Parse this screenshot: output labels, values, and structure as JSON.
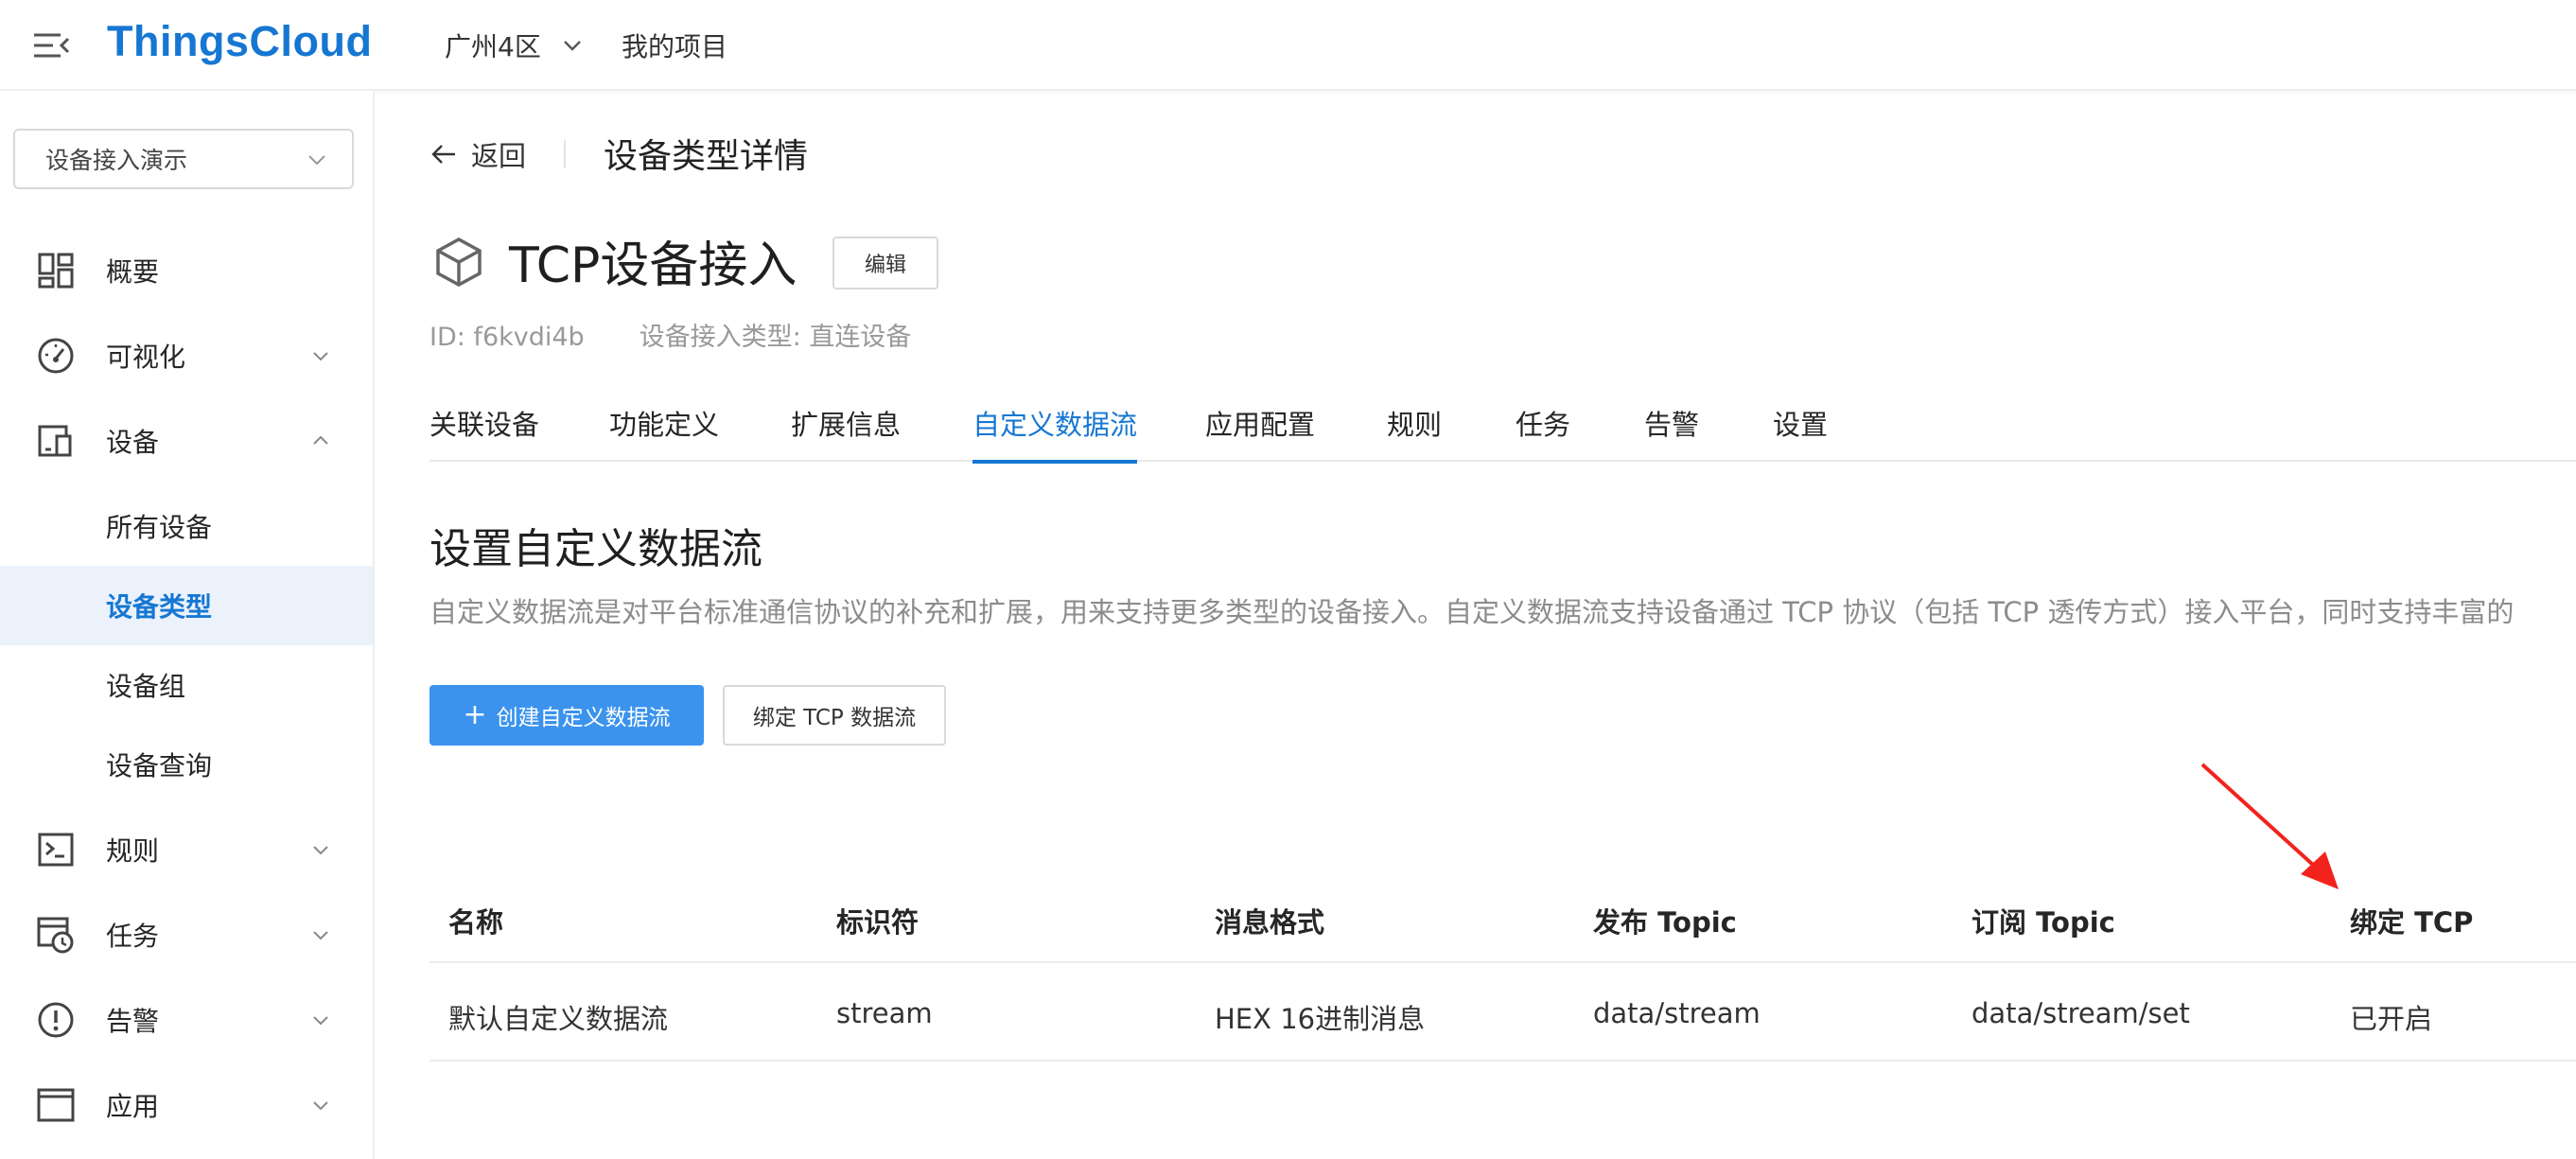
{
  "topbar": {
    "brand": "ThingsCloud",
    "region": "广州4区",
    "projects_link": "我的项目",
    "menu_icon": "menu-fold-icon"
  },
  "sidebar": {
    "project_select": "设备接入演示",
    "items": [
      {
        "label": "概要",
        "icon": "dashboard-icon"
      },
      {
        "label": "可视化",
        "icon": "gauge-icon"
      },
      {
        "label": "设备",
        "icon": "device-icon"
      },
      {
        "label": "规则",
        "icon": "terminal-icon"
      },
      {
        "label": "任务",
        "icon": "task-schedule-icon"
      },
      {
        "label": "告警",
        "icon": "alert-icon"
      },
      {
        "label": "应用",
        "icon": "app-window-icon"
      }
    ],
    "device_sub": [
      "所有设备",
      "设备类型",
      "设备组",
      "设备查询"
    ],
    "active_sub": "设备类型"
  },
  "header": {
    "back_label": "返回",
    "page_title": "设备类型详情"
  },
  "device": {
    "name": "TCP设备接入",
    "edit_label": "编辑",
    "id_text": "ID: f6kvdi4b",
    "access_type_text": "设备接入类型: 直连设备"
  },
  "tabs": [
    "关联设备",
    "功能定义",
    "扩展信息",
    "自定义数据流",
    "应用配置",
    "规则",
    "任务",
    "告警",
    "设置"
  ],
  "active_tab": "自定义数据流",
  "section": {
    "title": "设置自定义数据流",
    "description": "自定义数据流是对平台标准通信协议的补充和扩展，用来支持更多类型的设备接入。自定义数据流支持设备通过 TCP 协议（包括 TCP 透传方式）接入平台，同时支持丰富的"
  },
  "actions": {
    "create_label": "创建自定义数据流",
    "bind_label": "绑定 TCP 数据流"
  },
  "table": {
    "headers": [
      "名称",
      "标识符",
      "消息格式",
      "发布 Topic",
      "订阅 Topic",
      "绑定 TCP"
    ],
    "rows": [
      [
        "默认自定义数据流",
        "stream",
        "HEX 16进制消息",
        "data/stream",
        "data/stream/set",
        "已开启"
      ]
    ]
  },
  "colors": {
    "brand": "#1677d2",
    "primary_button": "#3b93ee",
    "active_bg": "#ebf2fc",
    "annotation_arrow": "#f2231d"
  }
}
